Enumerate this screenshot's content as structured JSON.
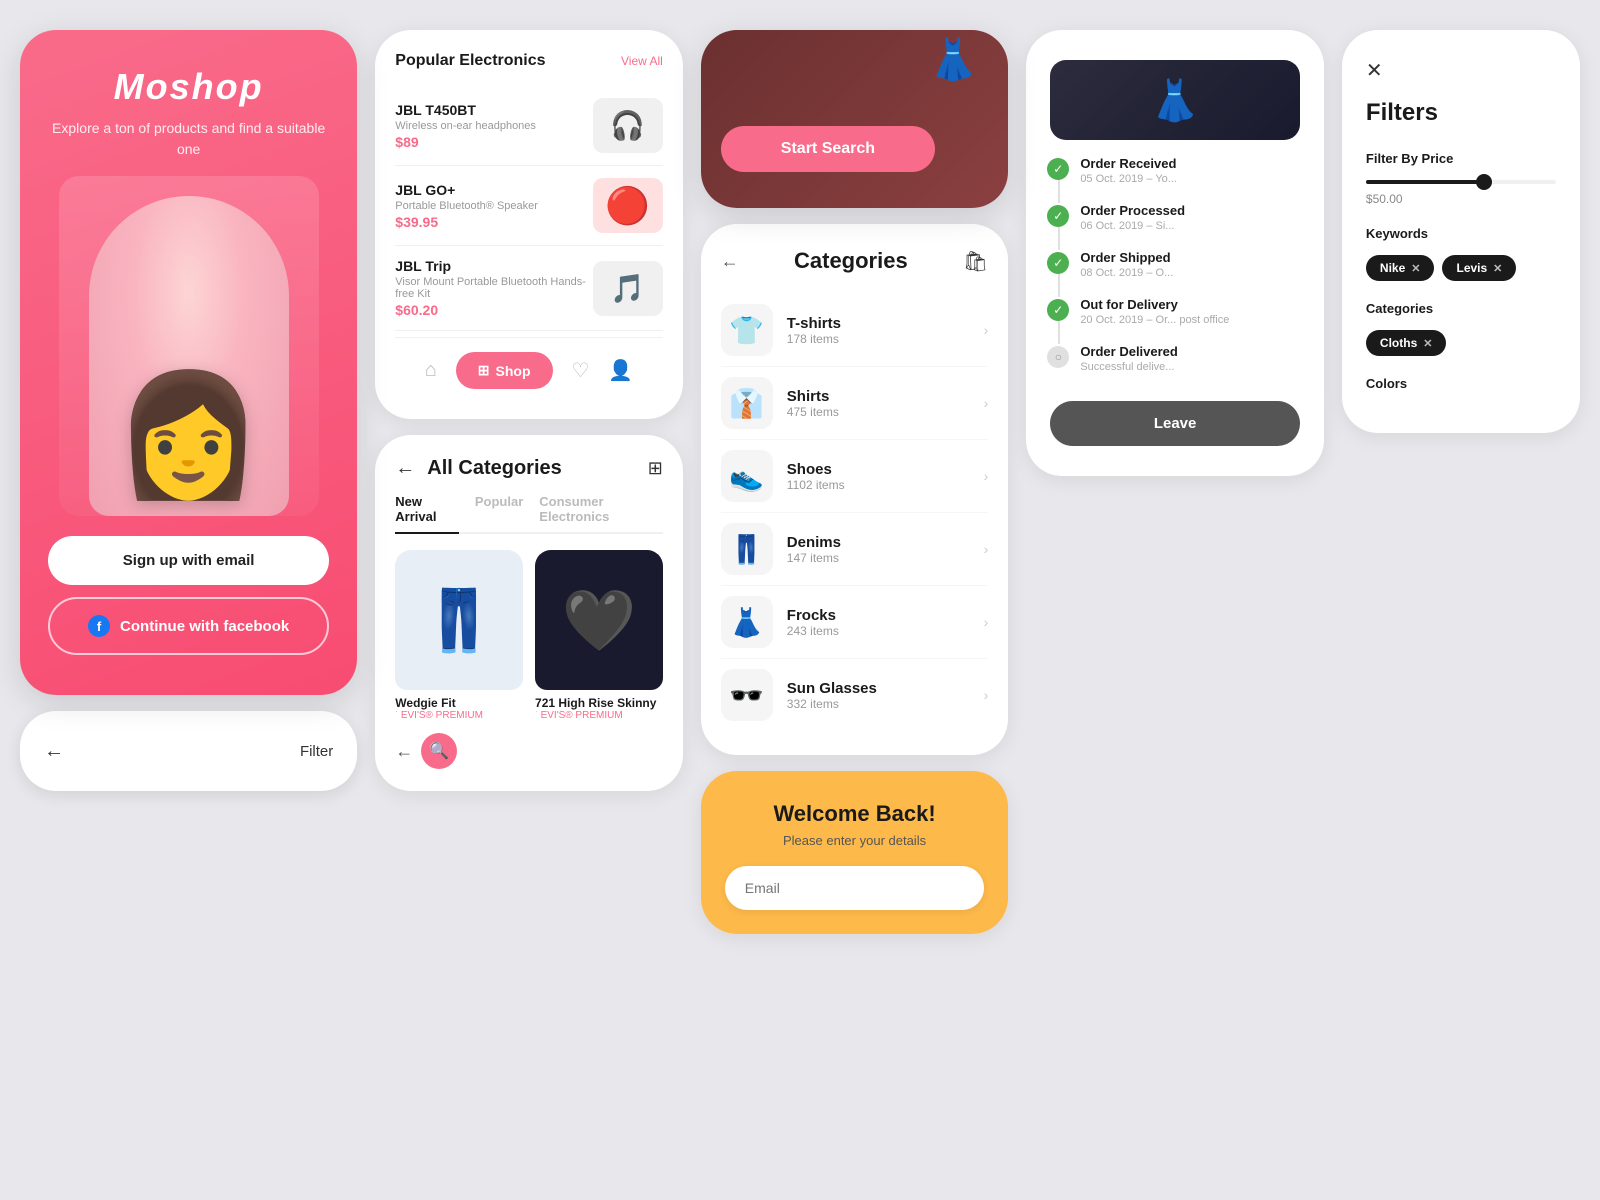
{
  "app": {
    "name": "Moshop",
    "tagline": "Explore a ton of products and\nfind a suitable one"
  },
  "moshop_card": {
    "signup_label": "Sign up with email",
    "facebook_label": "Continue with facebook"
  },
  "bottom_card": {
    "filter_label": "Filter"
  },
  "electronics": {
    "title": "Popular Electronics",
    "view_all": "View All",
    "products": [
      {
        "name": "JBL T450BT",
        "desc": "Wireless on-ear headphones",
        "price": "$89",
        "emoji": "🎧",
        "bg": "#f0f0f0"
      },
      {
        "name": "JBL GO+",
        "desc": "Portable Bluetooth® Speaker",
        "price": "$39.95",
        "emoji": "🔴",
        "bg": "#fff0f0"
      },
      {
        "name": "JBL Trip",
        "desc": "Visor Mount Portable Bluetooth Hands-free Kit",
        "price": "$60.20",
        "emoji": "🎵",
        "bg": "#f0f0f0"
      }
    ]
  },
  "nav": {
    "shop_label": "Shop"
  },
  "all_categories": {
    "title": "All Categories",
    "tabs": [
      "New Arrival",
      "Popular",
      "Consumer Electronics"
    ],
    "products": [
      {
        "name": "Wedgie Fit",
        "brand": "LEVI'S® PREMIUM",
        "type": "light_jeans"
      },
      {
        "name": "721 High Rise Skinny",
        "brand": "LEVI'S® PREMIUM",
        "type": "dark_jeans"
      }
    ]
  },
  "search_card": {
    "start_search": "Start Search"
  },
  "categories_card": {
    "title": "Categories",
    "items": [
      {
        "name": "T-shirts",
        "count": "178 items",
        "emoji": "👕"
      },
      {
        "name": "Shirts",
        "count": "475 items",
        "emoji": "👔"
      },
      {
        "name": "Shoes",
        "count": "1102 items",
        "emoji": "👟"
      },
      {
        "name": "Denims",
        "count": "147 items",
        "emoji": "👖"
      },
      {
        "name": "Frocks",
        "count": "243 items",
        "emoji": "👗"
      },
      {
        "name": "Sun Glasses",
        "count": "332 items",
        "emoji": "🕶️"
      }
    ]
  },
  "welcome_card": {
    "title": "Welcome Back!",
    "subtitle": "Please enter your details",
    "email_placeholder": "Email"
  },
  "order_tracking": {
    "steps": [
      {
        "label": "Order Received",
        "date": "05 Oct. 2019 – Yo...",
        "status": "green"
      },
      {
        "label": "Order Processed",
        "date": "06 Oct. 2019 – Si...",
        "status": "green"
      },
      {
        "label": "Order Shipped",
        "date": "08 Oct. 2019 – O...",
        "status": "green"
      },
      {
        "label": "Out for Delivery",
        "date": "20 Oct. 2019 – Or... post office",
        "status": "green"
      },
      {
        "label": "Order Delivered",
        "date": "Successful delive...",
        "status": "gray"
      }
    ],
    "leave_label": "Leave"
  },
  "filters": {
    "title": "Filters",
    "price_section": "Filter By Price",
    "price_value": "$50.00",
    "keywords_section": "Keywords",
    "keywords": [
      "Nike",
      "Levis"
    ],
    "categories_section": "Categories",
    "categories": [
      "Cloths"
    ],
    "colors_section": "Colors"
  }
}
